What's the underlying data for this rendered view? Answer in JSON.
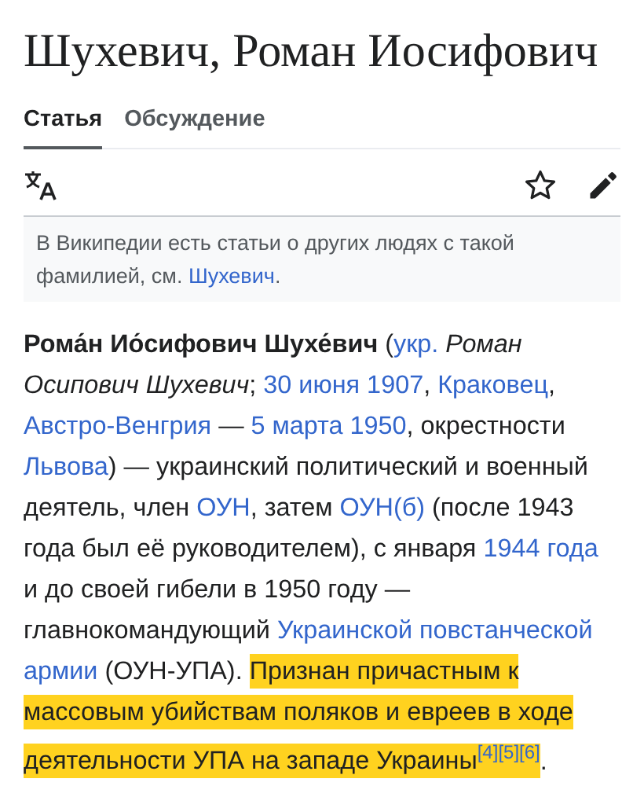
{
  "title": "Шухевич, Роман Иосифович",
  "tabs": [
    {
      "label": "Статья",
      "selected": true
    },
    {
      "label": "Обсуждение",
      "selected": false
    }
  ],
  "notice": {
    "text": "В Википедии есть статьи о других людях с такой фамилией, см. ",
    "link": "Шухевич",
    "end": "."
  },
  "paragraph": {
    "segments": [
      {
        "kind": "bold",
        "text": "Рома́н Ио́сифович Шухе́вич"
      },
      {
        "kind": "plain",
        "text": " ("
      },
      {
        "kind": "link",
        "text": "укр."
      },
      {
        "kind": "italic",
        "text": " Роман Осипович Шухевич"
      },
      {
        "kind": "plain",
        "text": "; "
      },
      {
        "kind": "link",
        "text": "30 июня 1907"
      },
      {
        "kind": "plain",
        "text": ", "
      },
      {
        "kind": "link",
        "text": "Краковец"
      },
      {
        "kind": "plain",
        "text": ", "
      },
      {
        "kind": "link",
        "text": "Австро-Венгрия"
      },
      {
        "kind": "plain",
        "text": " — "
      },
      {
        "kind": "link",
        "text": "5 марта 1950"
      },
      {
        "kind": "plain",
        "text": ", окрестности "
      },
      {
        "kind": "link",
        "text": "Львова"
      },
      {
        "kind": "plain",
        "text": ") — украинский политический и военный деятель, член "
      },
      {
        "kind": "link",
        "text": "ОУН"
      },
      {
        "kind": "plain",
        "text": ", затем "
      },
      {
        "kind": "link",
        "text": "ОУН(б)"
      },
      {
        "kind": "plain",
        "text": " (после 1943 года был её руководителем), с января "
      },
      {
        "kind": "link",
        "text": "1944 года"
      },
      {
        "kind": "plain",
        "text": " и до своей гибели в 1950 году — главнокомандующий "
      },
      {
        "kind": "link",
        "text": "Украинской повстанческой"
      },
      {
        "kind": "link",
        "text": "армии"
      },
      {
        "kind": "plain",
        "text": " (ОУН-УПА). "
      }
    ],
    "highlight": {
      "segments": [
        {
          "kind": "plain",
          "text": "Признан причастным к массовым убийствам поляков и евреев в ходе деятельности УПА на западе Украины"
        },
        {
          "kind": "cite",
          "text": "[4]"
        },
        {
          "kind": "cite",
          "text": "[5]"
        },
        {
          "kind": "cite",
          "text": "[6]"
        }
      ]
    },
    "end": "."
  }
}
